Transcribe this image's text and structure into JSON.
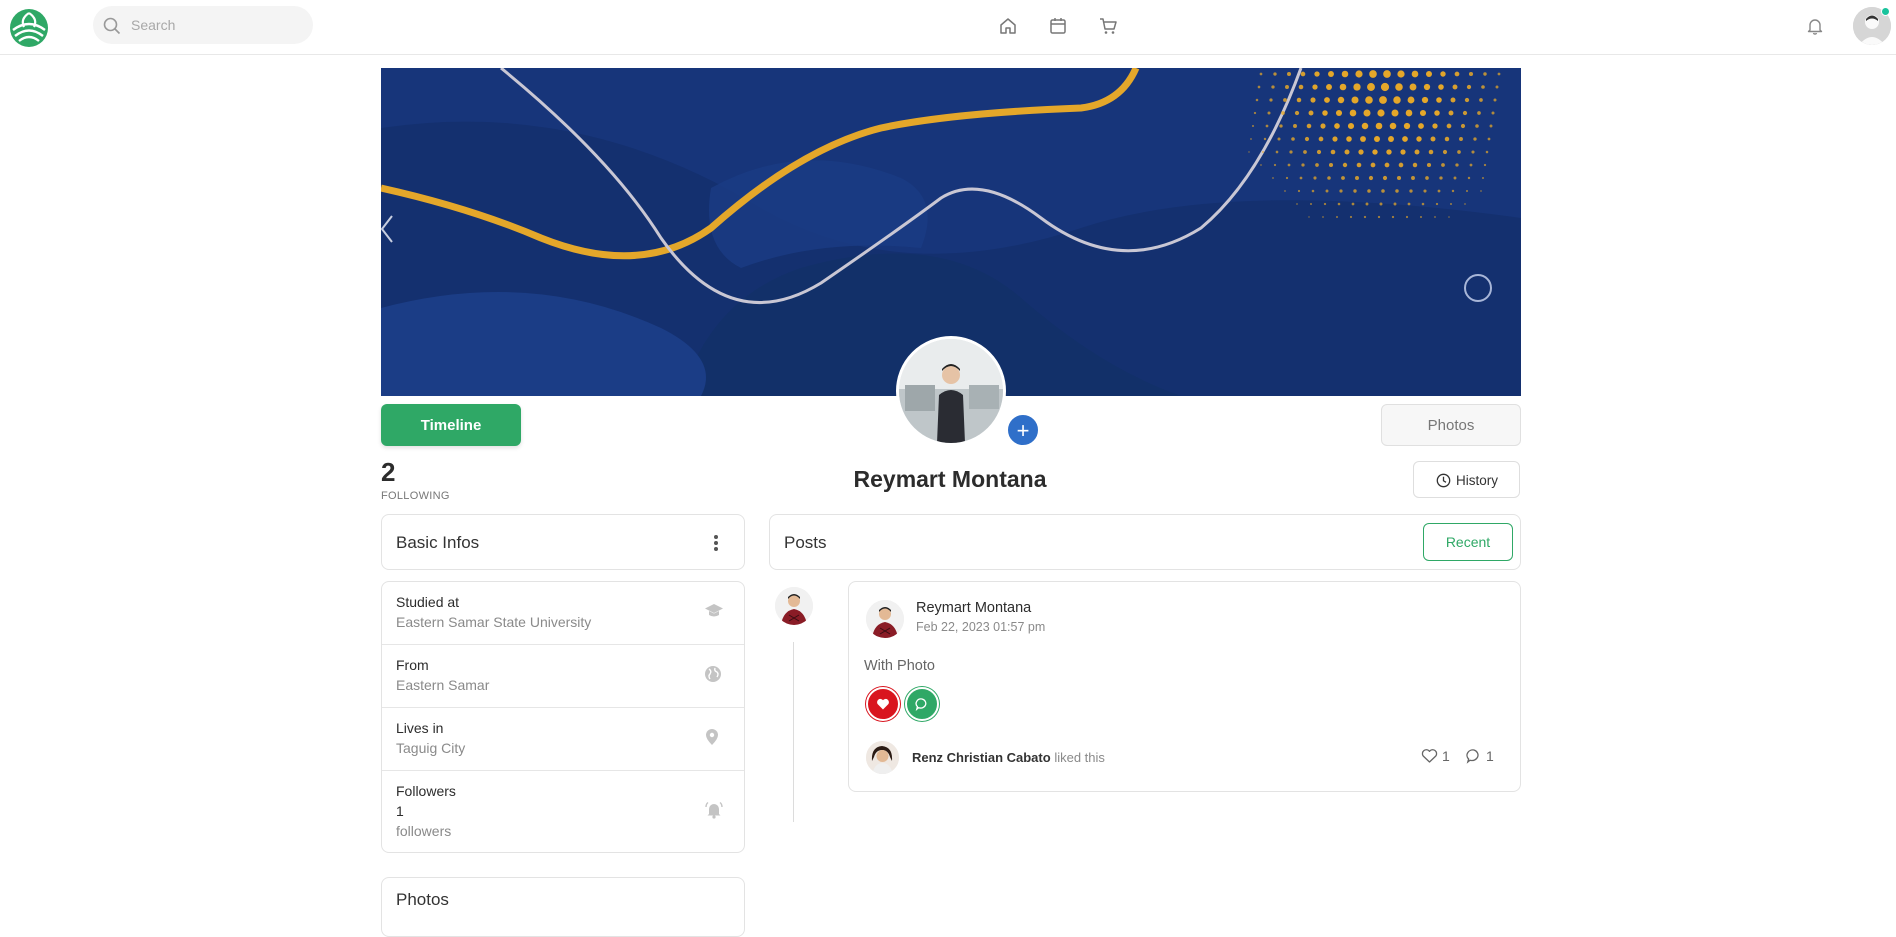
{
  "topbar": {
    "search_placeholder": "Search",
    "nav_icons": [
      "home-icon",
      "calendar-icon",
      "cart-icon"
    ],
    "brand_color": "#2fa866",
    "online_color": "#19c39c"
  },
  "profile": {
    "timeline_label": "Timeline",
    "photos_label": "Photos",
    "history_label": "History",
    "name": "Reymart Montana",
    "following_count": "2",
    "following_label": "FOLLOWING"
  },
  "basic_infos": {
    "title": "Basic Infos",
    "items": [
      {
        "label": "Studied at",
        "value": "Eastern Samar State University",
        "icon": "graduation-cap-icon"
      },
      {
        "label": "From",
        "value": "Eastern Samar",
        "icon": "globe-icon"
      },
      {
        "label": "Lives in",
        "value": "Taguig City",
        "icon": "map-pin-icon"
      },
      {
        "label": "Followers",
        "value": "1",
        "value2": "followers",
        "icon": "bell-ring-icon"
      }
    ]
  },
  "photos_card": {
    "title": "Photos"
  },
  "posts": {
    "title": "Posts",
    "recent_label": "Recent",
    "post": {
      "author": "Reymart Montana",
      "date": "Feb 22, 2023 01:57 pm",
      "text": "With Photo",
      "liker": "Renz Christian Cabato",
      "liker_suffix": "liked this",
      "likes": "1",
      "comments": "1"
    }
  },
  "colors": {
    "primary": "#2fa866",
    "cover_bg": "#17357a",
    "like_red": "#d9141e",
    "add_blue": "#2f6fc9"
  }
}
